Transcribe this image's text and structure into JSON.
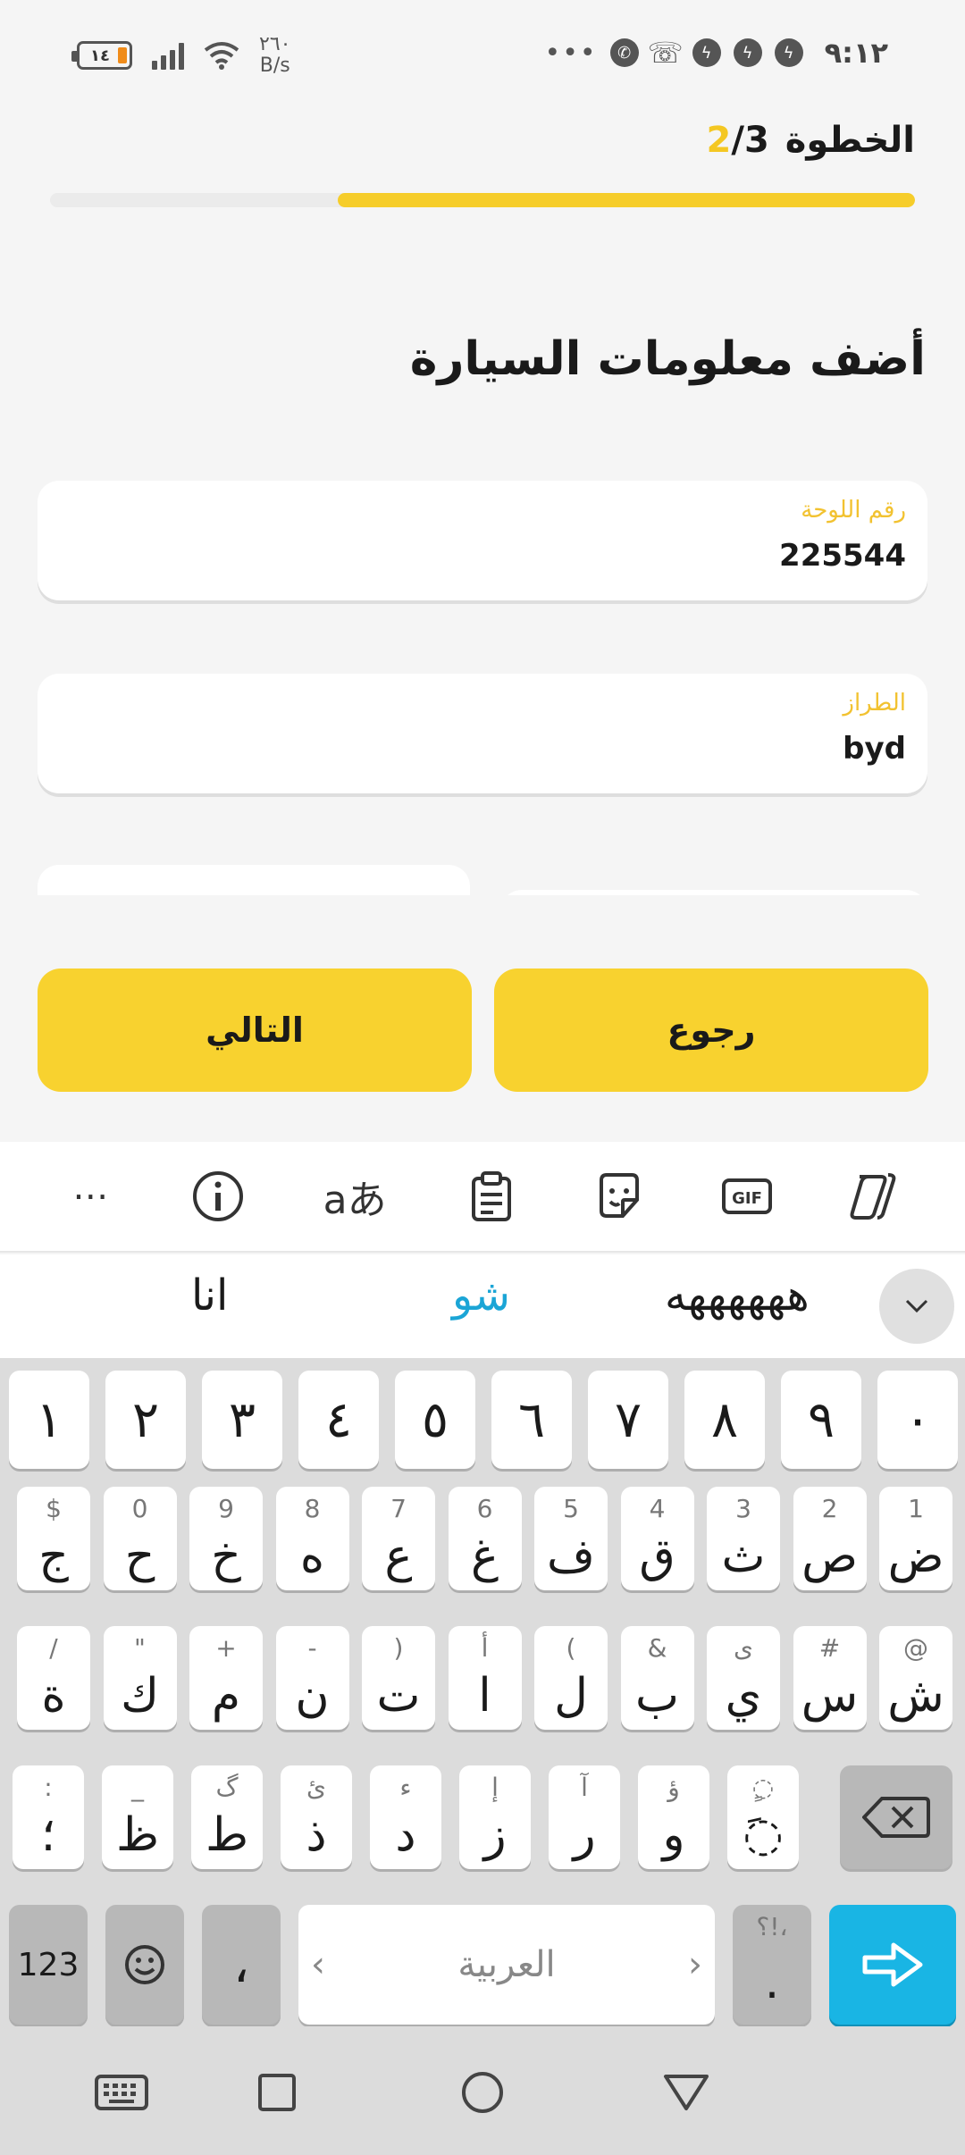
{
  "status_bar": {
    "battery": "١٤",
    "net_speed_value": "٢٦٠",
    "net_speed_unit": "B/s",
    "time": "٩:١٢",
    "icons": [
      "messenger-icon",
      "messenger-icon",
      "messenger-icon",
      "phone-call-icon",
      "viber-icon",
      "more-dots-icon"
    ]
  },
  "step": {
    "label": "الخطوة",
    "current": "2",
    "total": "/3",
    "progress_fraction": 0.667
  },
  "page_title": "أضف معلومات السيارة",
  "fields": {
    "plate_label": "رقم اللوحة",
    "plate_value": "225544",
    "model_label": "الطراز",
    "model_value": "byd"
  },
  "buttons": {
    "next": "التالي",
    "back": "رجوع"
  },
  "keyboard": {
    "toolbar_icons": [
      "copilot-icon",
      "gif-icon",
      "sticker-icon",
      "clipboard-icon",
      "translate-icon",
      "info-icon",
      "more-icon"
    ],
    "translate_glyph": "aあ",
    "gif_label": "GIF",
    "suggestions": [
      "ههههههه",
      "شو",
      "انا"
    ],
    "number_row": [
      "١",
      "٢",
      "٣",
      "٤",
      "٥",
      "٦",
      "٧",
      "٨",
      "٩",
      "٠"
    ],
    "row1": [
      {
        "hint": "1",
        "main": "ض"
      },
      {
        "hint": "2",
        "main": "ص"
      },
      {
        "hint": "3",
        "main": "ث"
      },
      {
        "hint": "4",
        "main": "ق"
      },
      {
        "hint": "5",
        "main": "ف"
      },
      {
        "hint": "6",
        "main": "غ"
      },
      {
        "hint": "7",
        "main": "ع"
      },
      {
        "hint": "8",
        "main": "ه"
      },
      {
        "hint": "9",
        "main": "خ"
      },
      {
        "hint": "0",
        "main": "ح"
      },
      {
        "hint": "$",
        "main": "ج"
      }
    ],
    "row2": [
      {
        "hint": "@",
        "main": "ش"
      },
      {
        "hint": "#",
        "main": "س"
      },
      {
        "hint": "ى",
        "main": "ي"
      },
      {
        "hint": "&",
        "main": "ب"
      },
      {
        "hint": "(",
        "main": "ل"
      },
      {
        "hint": "أ",
        "main": "ا"
      },
      {
        "hint": ")",
        "main": "ت"
      },
      {
        "hint": "-",
        "main": "ن"
      },
      {
        "hint": "+",
        "main": "م"
      },
      {
        "hint": "\"",
        "main": "ك"
      },
      {
        "hint": "/",
        "main": "ة"
      }
    ],
    "row3": [
      {
        "hint": ":",
        "main": "؛"
      },
      {
        "hint": "_",
        "main": "ظ"
      },
      {
        "hint": "گ",
        "main": "ط"
      },
      {
        "hint": "ئ",
        "main": "ذ"
      },
      {
        "hint": "ء",
        "main": "د"
      },
      {
        "hint": "إ",
        "main": "ز"
      },
      {
        "hint": "آ",
        "main": "ر"
      },
      {
        "hint": "ؤ",
        "main": "و"
      },
      {
        "hint": "ٍ◌",
        "main": "◌َ"
      }
    ],
    "numbers_key": "123",
    "comma_key": "،",
    "space_label": "العربية",
    "punct_hint": "؟!،",
    "punct_main": "."
  }
}
